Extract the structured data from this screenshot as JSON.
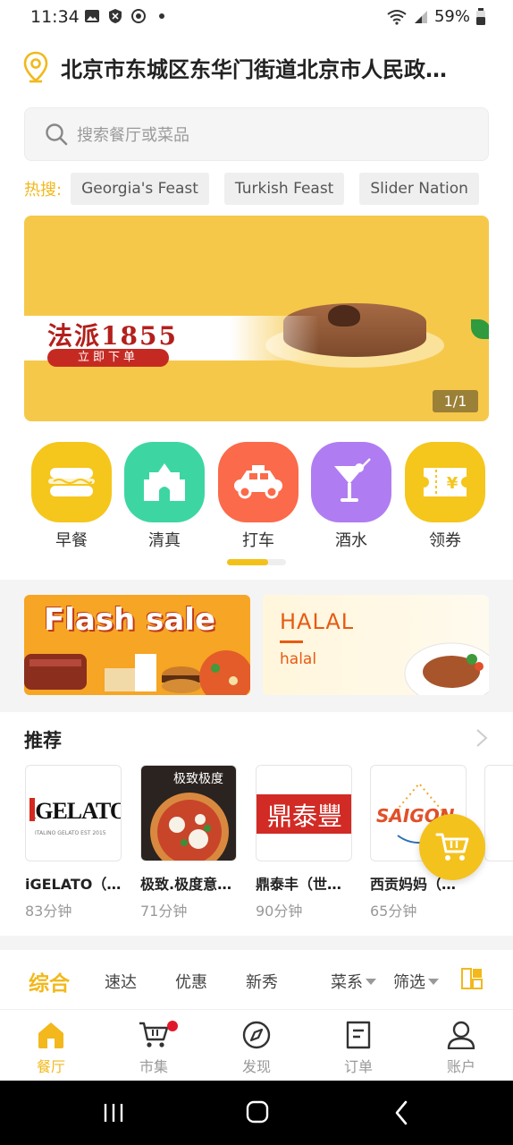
{
  "status_bar": {
    "time": "11:34",
    "battery": "59%",
    "icons_left": [
      "image-icon",
      "shield-icon",
      "sync-icon",
      "dot-icon"
    ],
    "icons_right": [
      "wifi-icon",
      "signal-icon",
      "battery-icon"
    ]
  },
  "location": {
    "address": "北京市东城区东华门街道北京市人民政…"
  },
  "search": {
    "placeholder": "搜索餐厅或菜品"
  },
  "hot_search": {
    "label": "热搜:",
    "tags": [
      "Georgia's Feast",
      "Turkish Feast",
      "Slider Nation"
    ]
  },
  "banner": {
    "title": "法派1855",
    "cta": "立即下单",
    "counter": "1/1"
  },
  "categories": [
    {
      "label": "早餐",
      "icon": "hotdog-icon",
      "color": "#f5c61c"
    },
    {
      "label": "清真",
      "icon": "mosque-icon",
      "color": "#3dd6a3"
    },
    {
      "label": "打车",
      "icon": "car-icon",
      "color": "#fb6a4a"
    },
    {
      "label": "酒水",
      "icon": "cocktail-icon",
      "color": "#b07cf2"
    },
    {
      "label": "领券",
      "icon": "coupon-icon",
      "color": "#f5c61c"
    }
  ],
  "promos": {
    "flash": "Flash sale",
    "halal_title": "HALAL",
    "halal_sub": "halal"
  },
  "recommend": {
    "title": "推荐",
    "items": [
      {
        "name": "iGELATO（…",
        "time": "83分钟",
        "logo": "iGELATO",
        "logo_sub": "ITALINO GELATO EST 2015"
      },
      {
        "name": "极致.极度意…",
        "time": "71分钟",
        "logo": "极致极度"
      },
      {
        "name": "鼎泰丰（世…",
        "time": "90分钟",
        "logo": "鼎泰豐"
      },
      {
        "name": "西贡妈妈（…",
        "time": "65分钟",
        "logo": "SAIGON"
      }
    ]
  },
  "sort_bar": {
    "items": [
      "综合",
      "速达",
      "优惠",
      "新秀"
    ],
    "dropdowns": [
      "菜系",
      "筛选"
    ]
  },
  "bottom_nav": [
    {
      "label": "餐厅",
      "icon": "home-icon",
      "active": true
    },
    {
      "label": "市集",
      "icon": "cart-icon",
      "active": false
    },
    {
      "label": "发现",
      "icon": "compass-icon",
      "active": false
    },
    {
      "label": "订单",
      "icon": "order-icon",
      "active": false
    },
    {
      "label": "账户",
      "icon": "user-icon",
      "active": false
    }
  ],
  "colors": {
    "accent": "#f2b81c",
    "halal": "#e85a12",
    "badge": "#e0192a"
  }
}
